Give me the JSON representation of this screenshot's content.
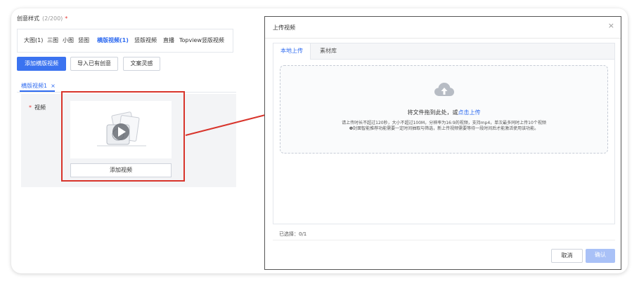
{
  "left_panel": {
    "section_title": "创意样式",
    "section_count": "(2/200)",
    "required_mark": "*",
    "style_tabs": [
      {
        "label": "大图(1)"
      },
      {
        "label": "三图"
      },
      {
        "label": "小图"
      },
      {
        "label": "竖图"
      },
      {
        "label": "横版视频(1)",
        "active": true
      },
      {
        "label": "竖版视频"
      },
      {
        "label": "直播"
      },
      {
        "label": "Topview竖版视频"
      }
    ],
    "buttons": {
      "add_horizontal_video": "添加横版视频",
      "import_existing": "导入已有创意",
      "copy_inspiration": "文案灵感"
    },
    "video_tab": {
      "label": "横版视频1",
      "close": "×"
    },
    "field_required": "*",
    "field_label": "视频",
    "add_video": "添加视频"
  },
  "modal": {
    "title": "上传视频",
    "close": "×",
    "tabs": [
      {
        "label": "本地上传",
        "active": true
      },
      {
        "label": "素材库"
      }
    ],
    "drop_text": "将文件拖到此处，或",
    "drop_link": "点击上传",
    "hint": "请上传时长不超过120秒，大小不超过100M，分辨率为16:9的视频，支持mp4，单次最多同时上传10个视频",
    "note": "❶封面智能推荐功能需要一定时间抽取与筛选，新上传视频需要等待一段时间后才能激活使用该功能。",
    "selected": "已选择：0/1",
    "cancel": "取消",
    "confirm": "确认"
  },
  "colors": {
    "accent": "#2f6bf0",
    "primary_button": "#3b73f0",
    "highlight_red": "#d8342b",
    "disabled_button": "#a9c1f7"
  }
}
